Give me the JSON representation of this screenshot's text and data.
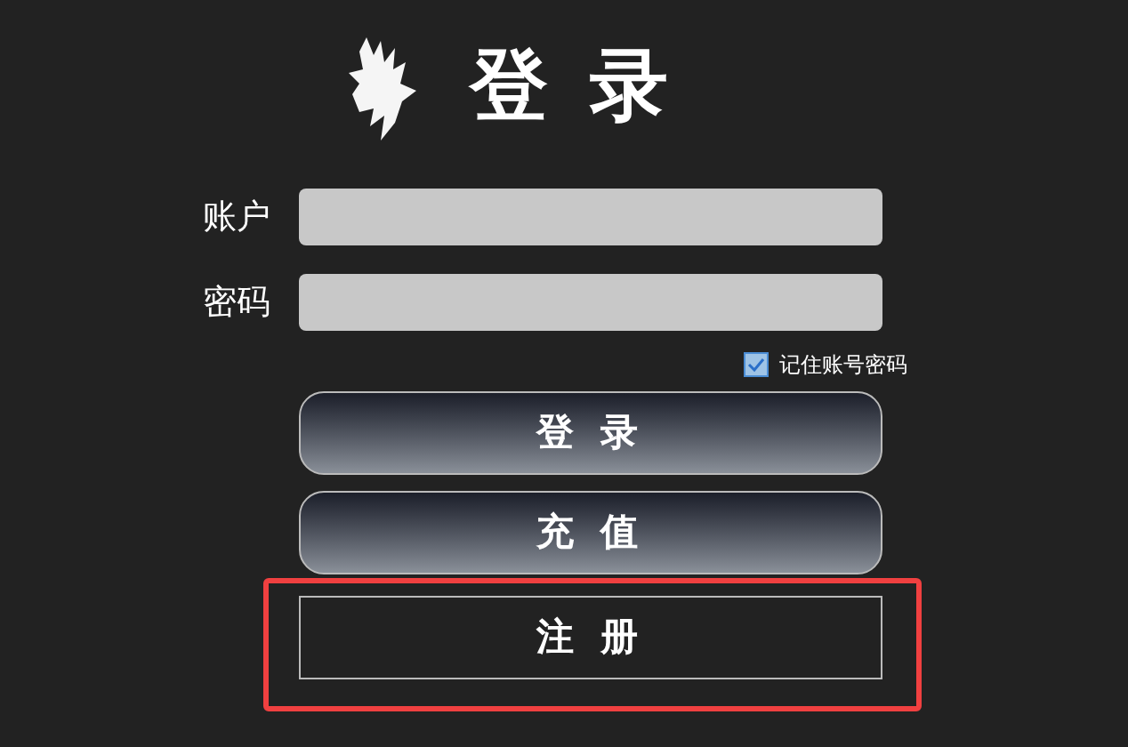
{
  "title": "登 录",
  "fields": [
    {
      "label": "账户"
    },
    {
      "label": "密码"
    }
  ],
  "remember": {
    "label": "记住账号密码",
    "checked": true
  },
  "buttons": [
    {
      "label": "登 录",
      "kind": "gradient",
      "highlighted": false
    },
    {
      "label": "充 值",
      "kind": "gradient",
      "highlighted": false
    },
    {
      "label": "注 册",
      "kind": "flat",
      "highlighted": true
    }
  ]
}
